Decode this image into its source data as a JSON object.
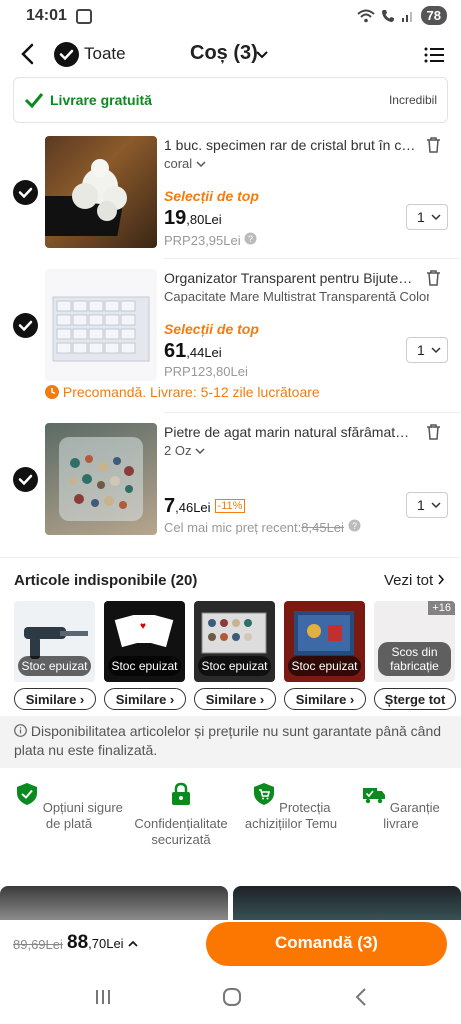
{
  "status": {
    "time": "14:01",
    "battery": "78"
  },
  "header": {
    "select_all": "Toate",
    "title": "Coș (3)"
  },
  "shipping": {
    "label": "Livrare gratuită",
    "right": "Incredibil"
  },
  "items": [
    {
      "name": "1 buc. specimen rar de cristal brut în cut...",
      "variant": "coral",
      "badge": "Selecții de top",
      "price_int": "19",
      "price_dec": ",80Lei",
      "rrp": "PRP23,95Lei",
      "qty": "1"
    },
    {
      "name": "Organizator Transparent pentru Bijuterii...",
      "variant": "Capacitate Mare Multistrat Transparentă Colora...",
      "badge": "Selecții de top",
      "price_int": "61",
      "price_dec": ",44Lei",
      "rrp": "PRP123,80Lei",
      "qty": "1",
      "preorder": "Precomandă. Livrare: 5-12 zile lucrătoare"
    },
    {
      "name": "Pietre de agat marin natural sfărâmate, p...",
      "variant": "2 Oz",
      "price_int": "7",
      "price_dec": ",46Lei",
      "discount": "-11%",
      "recent_label": "Cel mai mic preț recent:",
      "recent_price": "8,45Lei",
      "qty": "1"
    }
  ],
  "unavailable": {
    "title": "Articole indisponibile (20)",
    "see_all": "Vezi tot",
    "thumbs": [
      {
        "tag": "Stoc epuizat",
        "button": "Similare"
      },
      {
        "tag": "Stoc epuizat",
        "button": "Similare"
      },
      {
        "tag": "Stoc epuizat",
        "button": "Similare"
      },
      {
        "tag": "Stoc epuizat",
        "button": "Similare"
      },
      {
        "tag": "Scos din fabricație",
        "button": "Șterge tot",
        "more": "+16"
      }
    ]
  },
  "info": "Disponibilitatea articolelor și prețurile nu sunt garantate până când plata nu este finalizată.",
  "guarantees": [
    "Opțiuni sigure de plată",
    "Confidențialitate securizată",
    "Protecția achizițiilor Temu",
    "Garanție livrare"
  ],
  "bottom": {
    "old_total": "89,69Lei",
    "total_int": "88",
    "total_dec": ",70Lei",
    "order": "Comandă (3)"
  },
  "colors": {
    "accent": "#fb7701",
    "green": "#0a8a1f",
    "orange_text": "#f27c10"
  }
}
